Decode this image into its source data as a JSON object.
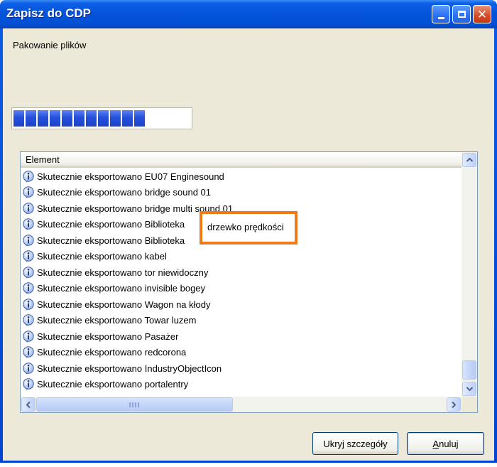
{
  "window": {
    "title": "Zapisz do CDP",
    "controls": [
      "minimize-icon",
      "maximize-icon",
      "close-icon"
    ]
  },
  "status_label": "Pakowanie plików",
  "progress": {
    "filled_segments": 11,
    "total_segments": 13,
    "fraction": 0.85
  },
  "list": {
    "header": "Element",
    "row_icon": "info-icon",
    "rows": [
      "Skutecznie eksportowano EU07 Enginesound",
      "Skutecznie eksportowano bridge sound 01",
      "Skutecznie eksportowano bridge multi sound 01",
      "Skutecznie eksportowano Biblioteka",
      "Skutecznie eksportowano Biblioteka",
      "Skutecznie eksportowano kabel",
      "Skutecznie eksportowano tor niewidoczny",
      "Skutecznie eksportowano invisible bogey",
      "Skutecznie eksportowano Wagon na kłody",
      "Skutecznie eksportowano Towar luzem",
      "Skutecznie eksportowano Pasażer",
      "Skutecznie eksportowano redcorona",
      "Skutecznie eksportowano IndustryObjectIcon",
      "Skutecznie eksportowano portalentry"
    ]
  },
  "annotation": {
    "text": "drzewko prędkości",
    "color": "#ee7a1a"
  },
  "buttons": {
    "hide_details": "Ukryj szczegóły",
    "cancel": "Anuluj"
  },
  "colors": {
    "titlebar": "#0453d9",
    "dialog_bg": "#ece9d8",
    "progress": "#2450dc"
  }
}
